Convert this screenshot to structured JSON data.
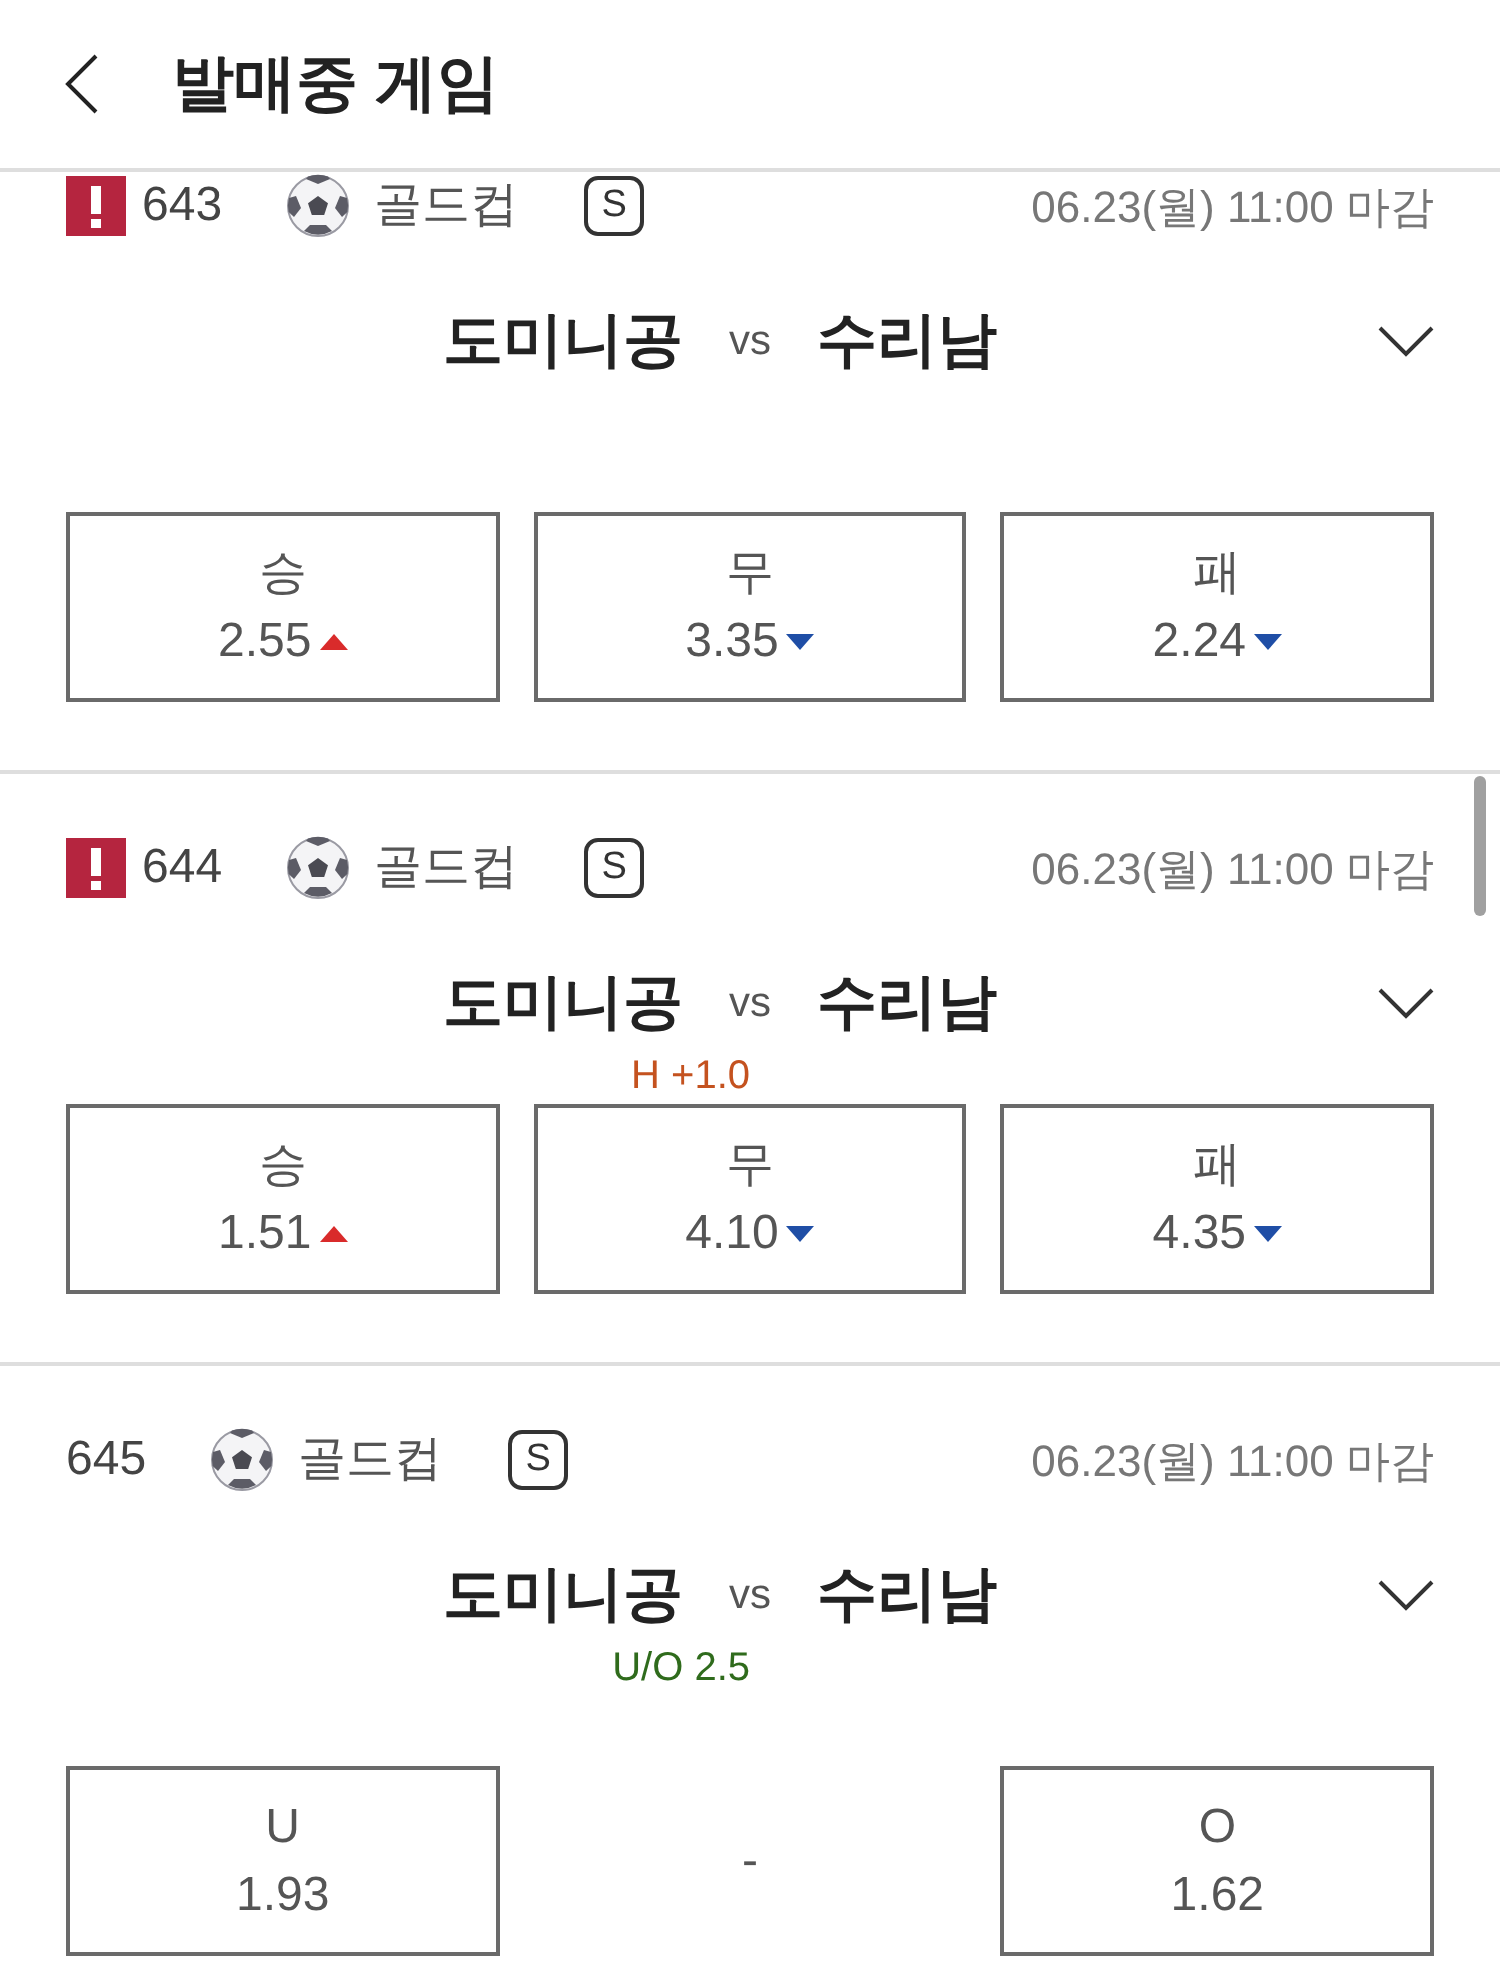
{
  "header": {
    "title": "발매중 게임"
  },
  "games": [
    {
      "alert": true,
      "number": "643",
      "league": "골드컵",
      "badge": "S",
      "deadline": "06.23(월) 11:00 마감",
      "home": "도미니공",
      "vs": "vs",
      "away": "수리남",
      "expanded": false,
      "options": [
        {
          "kind": "odds",
          "label": "승",
          "odds": "2.55",
          "rising": true
        },
        {
          "kind": "odds",
          "label": "무",
          "odds": "3.35",
          "rising": false
        },
        {
          "kind": "odds",
          "label": "패",
          "odds": "2.24",
          "rising": false
        }
      ]
    },
    {
      "alert": true,
      "number": "644",
      "league": "골드컵",
      "badge": "S",
      "deadline": "06.23(월) 11:00 마감",
      "home": "도미니공",
      "vs": "vs",
      "away": "수리남",
      "expanded": false,
      "line": {
        "kind": "handicap",
        "text": "H +1.0"
      },
      "options": [
        {
          "kind": "odds",
          "label": "승",
          "odds": "1.51",
          "rising": true
        },
        {
          "kind": "odds",
          "label": "무",
          "odds": "4.10",
          "rising": false
        },
        {
          "kind": "odds",
          "label": "패",
          "odds": "4.35",
          "rising": false
        }
      ]
    },
    {
      "alert": false,
      "number": "645",
      "league": "골드컵",
      "badge": "S",
      "deadline": "06.23(월) 11:00 마감",
      "home": "도미니공",
      "vs": "vs",
      "away": "수리남",
      "expanded": false,
      "line": {
        "kind": "over_under",
        "text": "U/O 2.5"
      },
      "options": [
        {
          "kind": "odds",
          "label": "U",
          "odds": "1.93"
        },
        {
          "kind": "empty",
          "label": "-"
        },
        {
          "kind": "odds",
          "label": "O",
          "odds": "1.62"
        }
      ]
    }
  ]
}
